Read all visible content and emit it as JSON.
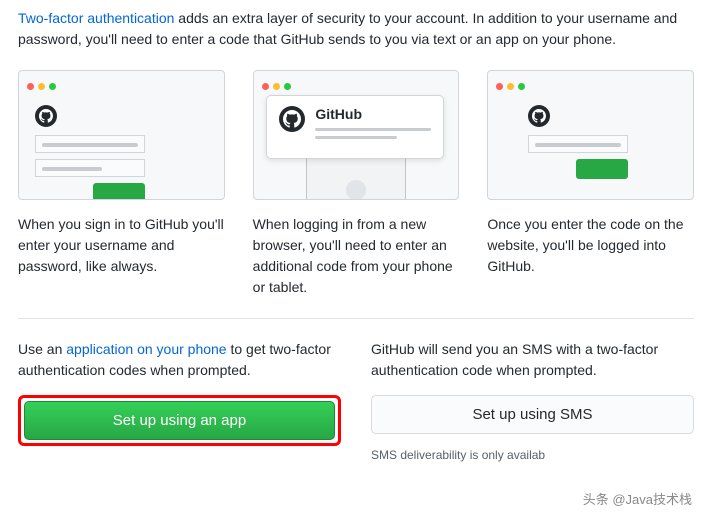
{
  "intro": {
    "link": "Two-factor authentication",
    "rest": " adds an extra layer of security to your account. In addition to your username and password, you'll need to enter a code that GitHub sends to you via text or an app on your phone."
  },
  "gh_card_title": "GitHub",
  "captions": {
    "c1": "When you sign in to GitHub you'll enter your username and password, like always.",
    "c2": "When logging in from a new browser, you'll need to enter an additional code from your phone or tablet.",
    "c3": "Once you enter the code on the website, you'll be logged into GitHub."
  },
  "setup": {
    "app_pre": "Use an ",
    "app_link": "application on your phone",
    "app_post": " to get two-factor authentication codes when prompted.",
    "app_button": "Set up using an app",
    "sms_text": "GitHub will send you an SMS with a two-factor authentication code when prompted.",
    "sms_button": "Set up using SMS",
    "sms_note": "SMS deliverability is only availab"
  },
  "watermark": "头条 @Java技术栈"
}
